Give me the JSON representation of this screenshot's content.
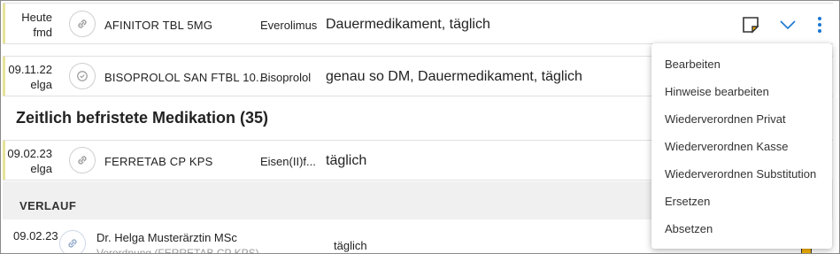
{
  "rows": [
    {
      "date": "Heute",
      "user": "fmd",
      "drug": "AFINITOR TBL 5MG",
      "active": "Everolimus",
      "dose": "Dauermedikament, täglich"
    },
    {
      "date": "09.11.22",
      "user": "elga",
      "drug": "BISOPROLOL SAN FTBL 10...",
      "active": "Bisoprolol",
      "dose": "genau so DM, Dauermedikament, täglich"
    },
    {
      "date": "09.02.23",
      "user": "elga",
      "drug": "FERRETAB CP KPS",
      "active": "Eisen(II)f...",
      "dose": "täglich"
    }
  ],
  "section": {
    "title": "Zeitlich befristete Medikation (35)"
  },
  "verlauf": {
    "label": "VERLAUF",
    "date": "09.02.23",
    "name": "Dr. Helga Musterärztin MSc",
    "sub": "Verordnung (FERRETAB CP KPS)",
    "dose": "täglich"
  },
  "menu": {
    "items": [
      "Bearbeiten",
      "Hinweise bearbeiten",
      "Wiederverordnen Privat",
      "Wiederverordnen Kasse",
      "Wiederverordnen Substitution",
      "Ersetzen",
      "Absetzen"
    ]
  },
  "icons": {
    "row1_status": "link-icon",
    "row2_status": "check-circle-icon",
    "row3_status": "link-icon",
    "note": "note-icon",
    "expand": "chevron-down-icon",
    "more": "more-vertical-icon"
  },
  "colors": {
    "accent": "#1976d2",
    "note_fill": "#f5b400",
    "stripe": "#e6e39a"
  }
}
